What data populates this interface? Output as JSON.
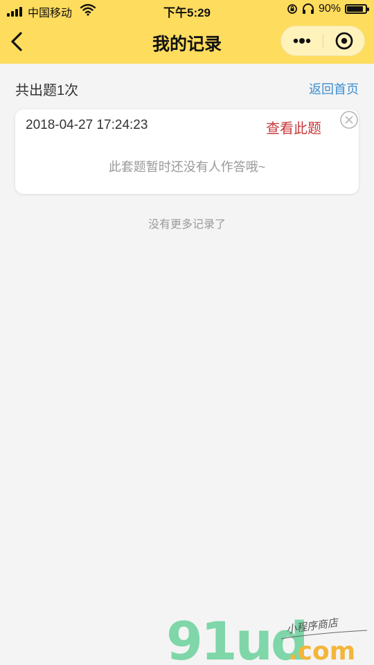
{
  "status_bar": {
    "carrier": "中国移动",
    "time": "下午5:29",
    "battery_percent": "90%",
    "battery_level": 0.9,
    "icons": [
      "signal-icon",
      "wifi-icon",
      "orientation-lock-icon",
      "headphones-icon",
      "battery-icon"
    ]
  },
  "nav": {
    "title": "我的记录",
    "back_icon": "chevron-left-icon",
    "more_icon": "more-dots-icon",
    "close_icon": "target-circle-icon",
    "background": "#fedc5e"
  },
  "summary": {
    "total_label": "共出题1次",
    "home_link": "返回首页"
  },
  "records": [
    {
      "time": "2018-04-27 17:24:23",
      "view_label": "查看此题",
      "empty_note": "此套题暂时还没有人作答哦~"
    }
  ],
  "footer_note": "没有更多记录了",
  "watermark": {
    "logo_text": "91ud",
    "domain_text": ".com",
    "slogan": "小程序商店"
  },
  "colors": {
    "accent_yellow": "#fedc5e",
    "link_blue": "#3d8ed0",
    "action_red": "#c8383a",
    "watermark_green": "#7fd6a8",
    "watermark_orange": "#f3b63a"
  }
}
